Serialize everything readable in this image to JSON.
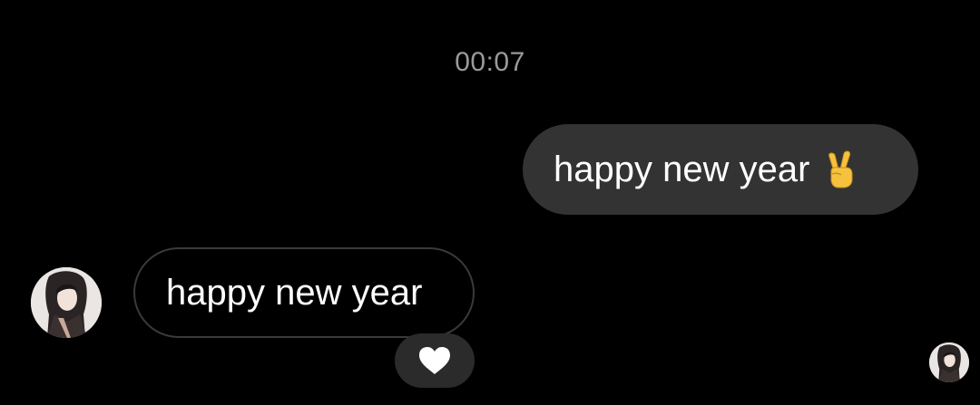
{
  "thread": {
    "timestamp": "00:07"
  },
  "messages": [
    {
      "direction": "outgoing",
      "text": "happy new year",
      "emoji_icon": "victory-hand-emoji-icon",
      "bubble_color": "#333333"
    },
    {
      "direction": "incoming",
      "text": "happy new year",
      "reaction_icon": "white-heart-icon",
      "bubble_border_color": "#3a3a3a",
      "reaction_bg_color": "#2b2b2b"
    }
  ],
  "avatars": {
    "sender_icon": "sender-avatar-icon",
    "seen_icon": "seen-receipt-avatar-icon"
  },
  "colors": {
    "background": "#000000",
    "timestamp": "#9a9a9a",
    "text": "#ffffff"
  }
}
